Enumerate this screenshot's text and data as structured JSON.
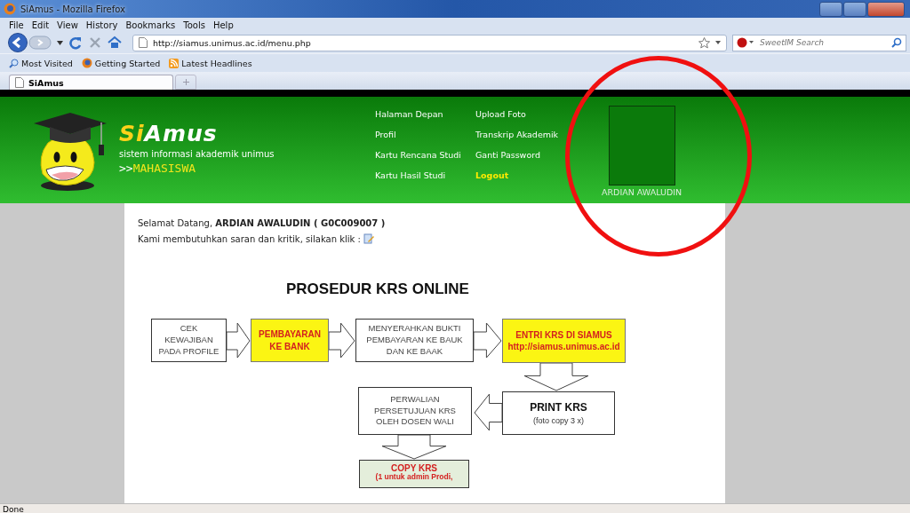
{
  "window": {
    "title": "SiAmus - Mozilla Firefox"
  },
  "menu_bar": [
    "File",
    "Edit",
    "View",
    "History",
    "Bookmarks",
    "Tools",
    "Help"
  ],
  "address_bar": {
    "url": "http://siamus.unimus.ac.id/menu.php"
  },
  "search": {
    "placeholder": "SweetIM Search"
  },
  "bookmarks": [
    {
      "label": "Most Visited",
      "kind": "search"
    },
    {
      "label": "Getting Started",
      "kind": "firefox"
    },
    {
      "label": "Latest Headlines",
      "kind": "feed"
    }
  ],
  "tabs": [
    {
      "label": "SiAmus",
      "selected": true
    }
  ],
  "site": {
    "logo": [
      "Si",
      "Amus"
    ],
    "tagline": "sistem informasi akademik unimus",
    "role": [
      ">>",
      "MAHASISWA"
    ],
    "nav": [
      {
        "label": "Halaman Depan",
        "kind": "link"
      },
      {
        "label": "Profil",
        "kind": "link"
      },
      {
        "label": "Kartu Rencana Studi",
        "kind": "link"
      },
      {
        "label": "Kartu Hasil Studi",
        "kind": "link"
      },
      {
        "label": "Upload Foto",
        "kind": "link"
      },
      {
        "label": "Transkrip Akademik",
        "kind": "link"
      },
      {
        "label": "Ganti Password",
        "kind": "link"
      },
      {
        "label": "Logout",
        "kind": "logout"
      }
    ],
    "profile": {
      "name": "ARDIAN AWALUDIN"
    }
  },
  "greeting": "Selamat Datang, **ARDIAN AWALUDIN ( G0C009007 )**",
  "feedback": "Kami membutuhkan saran dan kritik, silakan klik :",
  "procedure": {
    "title": "PROSEDUR KRS ONLINE",
    "steps": [
      {
        "kind": "plain",
        "text": "CEK\nKEWAJIBAN\nPADA PROFILE"
      },
      {
        "kind": "highlight",
        "text": "PEMBAYARAN\nKE BANK"
      },
      {
        "kind": "plain",
        "text": "MENYERAHKAN BUKTI\nPEMBAYARAN KE BAUK\nDAN KE BAAK"
      },
      {
        "kind": "highlight",
        "text": "ENTRI KRS DI SIAMUS\nhttp://siamus.unimus.ac.id"
      },
      {
        "kind": "plain",
        "text": "PERWALIAN\nPERSETUJUAN KRS\nOLEH DOSEN WALI"
      },
      {
        "kind": "titled",
        "title": "PRINT KRS",
        "note": "(foto copy 3 x)"
      },
      {
        "kind": "copy",
        "title": "COPY KRS",
        "note": "(1 untuk admin Prodi,"
      }
    ]
  },
  "status_bar": "Done"
}
